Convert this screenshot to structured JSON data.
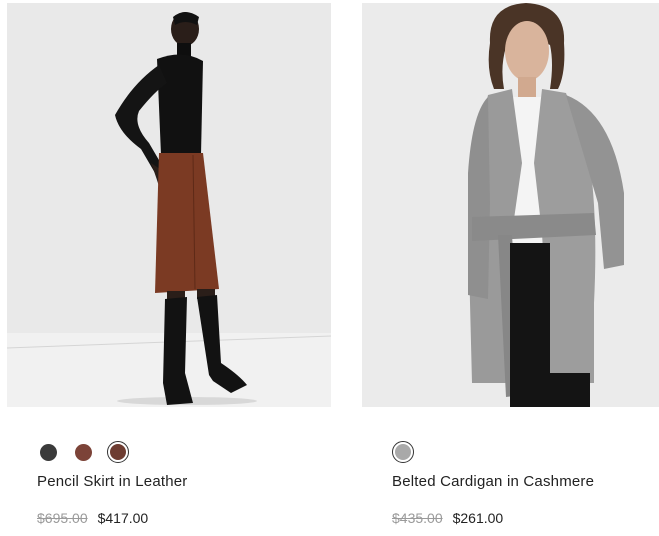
{
  "products": [
    {
      "name": "Pencil Skirt in Leather",
      "original_price": "$695.00",
      "sale_price": "$417.00",
      "image_alt": "Model in black turtleneck, brown leather pencil skirt and black knee-high boots",
      "swatches": [
        {
          "color": "#3b3b3b",
          "label": "Black",
          "selected": false
        },
        {
          "color": "#7c4338",
          "label": "Brown",
          "selected": false
        },
        {
          "color": "#6e3d32",
          "label": "Cognac",
          "selected": true
        }
      ]
    },
    {
      "name": "Belted Cardigan in Cashmere",
      "original_price": "$435.00",
      "sale_price": "$261.00",
      "image_alt": "Model in grey belted cashmere cardigan over white top and black trousers",
      "swatches": [
        {
          "color": "#a9a9a9",
          "label": "Grey",
          "selected": true
        }
      ]
    }
  ],
  "colors": {
    "background": "#ffffff",
    "photo_background": "#ebebeb",
    "price_strike": "#9a9a9a"
  }
}
